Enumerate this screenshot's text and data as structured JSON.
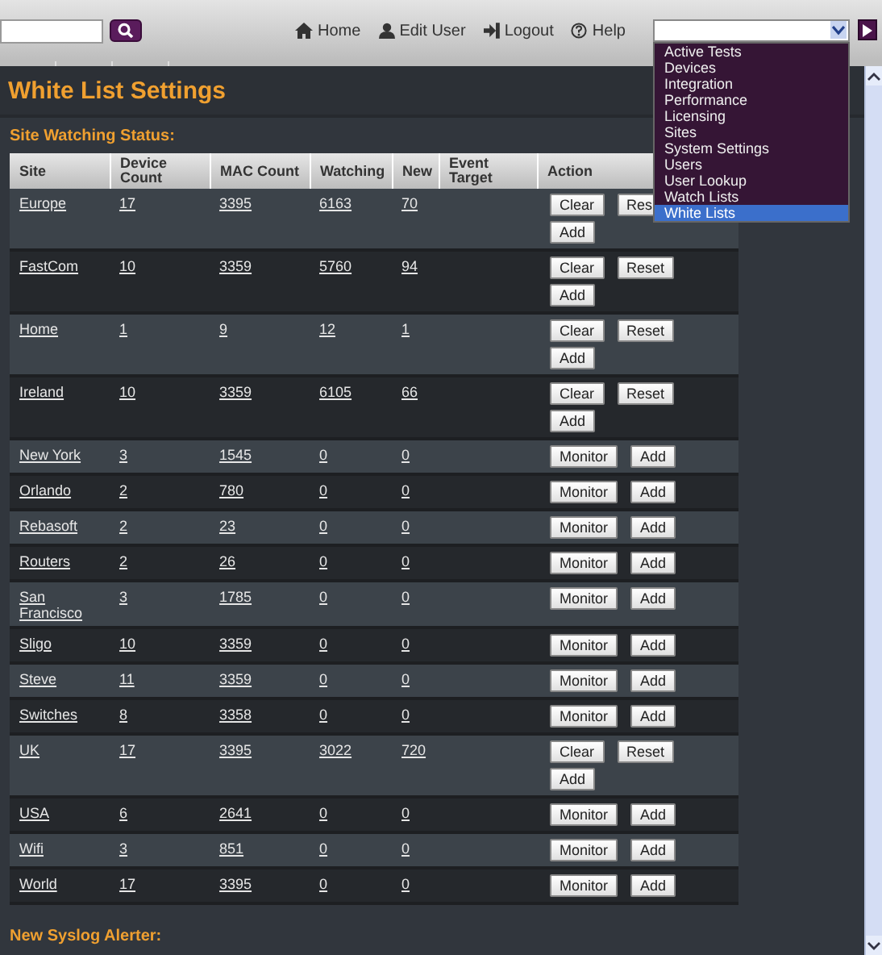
{
  "top_bar": {
    "nav": [
      {
        "kind": "home",
        "label": "Home"
      },
      {
        "kind": "user",
        "label": "Edit User"
      },
      {
        "kind": "logout",
        "label": "Logout"
      },
      {
        "kind": "help",
        "label": "Help"
      }
    ],
    "menu_select": {
      "expanded": true,
      "options": [
        {
          "label": "Active Tests",
          "selected": false
        },
        {
          "label": "Devices",
          "selected": false
        },
        {
          "label": "Integration",
          "selected": false
        },
        {
          "label": "Performance",
          "selected": false
        },
        {
          "label": "Licensing",
          "selected": false
        },
        {
          "label": "Sites",
          "selected": false
        },
        {
          "label": "System Settings",
          "selected": false
        },
        {
          "label": "Users",
          "selected": false
        },
        {
          "label": "User Lookup",
          "selected": false
        },
        {
          "label": "Watch Lists",
          "selected": false
        },
        {
          "label": "White Lists",
          "selected": true
        }
      ]
    }
  },
  "page_title": "White List Settings",
  "section_title": "Site Watching Status:",
  "table": {
    "columns": [
      "Site",
      "Device Count",
      "MAC Count",
      "Watching",
      "New",
      "Event Target",
      "Action"
    ],
    "rows": [
      {
        "cells": [
          "Europe",
          "17",
          "3395",
          "6163",
          "70",
          ""
        ],
        "actions": [
          [
            "Clear",
            "Res"
          ],
          [
            "Add"
          ]
        ]
      },
      {
        "cells": [
          "FastCom",
          "10",
          "3359",
          "5760",
          "94",
          ""
        ],
        "actions": [
          [
            "Clear",
            "Reset"
          ],
          [
            "Add"
          ]
        ]
      },
      {
        "cells": [
          "Home",
          "1",
          "9",
          "12",
          "1",
          ""
        ],
        "actions": [
          [
            "Clear",
            "Reset"
          ],
          [
            "Add"
          ]
        ]
      },
      {
        "cells": [
          "Ireland",
          "10",
          "3359",
          "6105",
          "66",
          ""
        ],
        "actions": [
          [
            "Clear",
            "Reset"
          ],
          [
            "Add"
          ]
        ]
      },
      {
        "cells": [
          "New York",
          "3",
          "1545",
          "0",
          "0",
          ""
        ],
        "actions": [
          [
            "Monitor",
            "Add"
          ]
        ]
      },
      {
        "cells": [
          "Orlando",
          "2",
          "780",
          "0",
          "0",
          ""
        ],
        "actions": [
          [
            "Monitor",
            "Add"
          ]
        ]
      },
      {
        "cells": [
          "Rebasoft",
          "2",
          "23",
          "0",
          "0",
          ""
        ],
        "actions": [
          [
            "Monitor",
            "Add"
          ]
        ]
      },
      {
        "cells": [
          "Routers",
          "2",
          "26",
          "0",
          "0",
          ""
        ],
        "actions": [
          [
            "Monitor",
            "Add"
          ]
        ]
      },
      {
        "cells": [
          "San Francisco",
          "3",
          "1785",
          "0",
          "0",
          ""
        ],
        "actions": [
          [
            "Monitor",
            "Add"
          ]
        ]
      },
      {
        "cells": [
          "Sligo",
          "10",
          "3359",
          "0",
          "0",
          ""
        ],
        "actions": [
          [
            "Monitor",
            "Add"
          ]
        ]
      },
      {
        "cells": [
          "Steve",
          "11",
          "3359",
          "0",
          "0",
          ""
        ],
        "actions": [
          [
            "Monitor",
            "Add"
          ]
        ]
      },
      {
        "cells": [
          "Switches",
          "8",
          "3358",
          "0",
          "0",
          ""
        ],
        "actions": [
          [
            "Monitor",
            "Add"
          ]
        ]
      },
      {
        "cells": [
          "UK",
          "17",
          "3395",
          "3022",
          "720",
          ""
        ],
        "actions": [
          [
            "Clear",
            "Reset"
          ],
          [
            "Add"
          ]
        ]
      },
      {
        "cells": [
          "USA",
          "6",
          "2641",
          "0",
          "0",
          ""
        ],
        "actions": [
          [
            "Monitor",
            "Add"
          ]
        ]
      },
      {
        "cells": [
          "Wifi",
          "3",
          "851",
          "0",
          "0",
          ""
        ],
        "actions": [
          [
            "Monitor",
            "Add"
          ]
        ]
      },
      {
        "cells": [
          "World",
          "17",
          "3395",
          "0",
          "0",
          ""
        ],
        "actions": [
          [
            "Monitor",
            "Add"
          ]
        ]
      }
    ]
  },
  "next_section_title": "New Syslog Alerter:"
}
